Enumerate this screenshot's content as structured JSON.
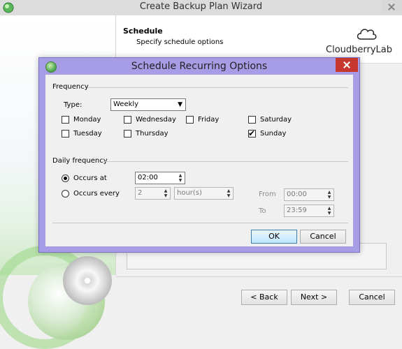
{
  "wizard": {
    "title": "Create Backup Plan Wizard",
    "header_title": "Schedule",
    "header_subtitle": "Specify schedule options",
    "brand": "CloudberryLab",
    "buttons": {
      "back": "< Back",
      "next": "Next >",
      "cancel": "Cancel"
    }
  },
  "dialog": {
    "title": "Schedule Recurring Options",
    "frequency": {
      "group_label": "Frequency",
      "type_label": "Type:",
      "type_value": "Weekly",
      "days": [
        {
          "label": "Monday",
          "checked": false
        },
        {
          "label": "Wednesday",
          "checked": false
        },
        {
          "label": "Friday",
          "checked": false
        },
        {
          "label": "Saturday",
          "checked": false
        },
        {
          "label": "Tuesday",
          "checked": false
        },
        {
          "label": "Thursday",
          "checked": false
        },
        {
          "label": "Sunday",
          "checked": true
        }
      ]
    },
    "daily": {
      "group_label": "Daily frequency",
      "occurs_at_label": "Occurs at",
      "occurs_at_value": "02:00",
      "occurs_every_label": "Occurs every",
      "every_value": "2",
      "unit_value": "hour(s)",
      "from_label": "From",
      "from_value": "00:00",
      "to_label": "To",
      "to_value": "23:59",
      "selected": "occurs_at"
    },
    "buttons": {
      "ok": "OK",
      "cancel": "Cancel"
    }
  },
  "colors": {
    "dialog_frame": "#a79de6",
    "close_red": "#c7372f",
    "ok_accent": "#3c7fb1"
  }
}
